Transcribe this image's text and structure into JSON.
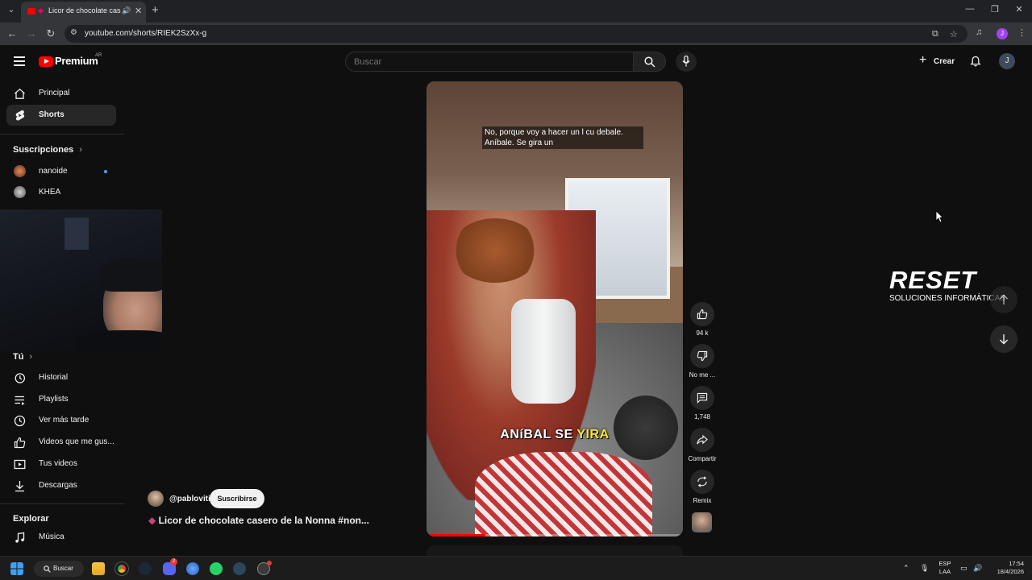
{
  "browser": {
    "tab_title": "Licor de chocolate casero",
    "url": "youtube.com/shorts/RIEK2SzXx-g",
    "profile_initial": "J"
  },
  "header": {
    "brand": "Premium",
    "country_code": "AR",
    "search_placeholder": "Buscar",
    "create_label": "Crear",
    "avatar_initial": "J"
  },
  "sidebar": {
    "nav": [
      {
        "label": "Principal",
        "icon": "home-icon"
      },
      {
        "label": "Shorts",
        "icon": "shorts-icon"
      }
    ],
    "subscriptions_heading": "Suscripciones",
    "subscriptions": [
      {
        "label": "nanoide",
        "live_dot": true
      },
      {
        "label": "KHEA",
        "live_dot": false
      }
    ],
    "you_heading": "Tú",
    "you_items": [
      {
        "label": "Historial",
        "icon": "history-icon"
      },
      {
        "label": "Playlists",
        "icon": "playlists-icon"
      },
      {
        "label": "Ver más tarde",
        "icon": "watch-later-icon"
      },
      {
        "label": "Videos que me gus...",
        "icon": "liked-videos-icon"
      },
      {
        "label": "Tus videos",
        "icon": "your-videos-icon"
      },
      {
        "label": "Descargas",
        "icon": "downloads-icon"
      }
    ],
    "explore_heading": "Explorar",
    "explore_items": [
      {
        "label": "Música",
        "icon": "music-icon"
      }
    ]
  },
  "short": {
    "caption_top": "No, porque voy a hacer un l cu debale. Aníbale. Se gira un",
    "caption_big_a": "ANíBAL SE ",
    "caption_big_b": "YIRA",
    "progress": 0.23,
    "channel": "@pabloviti",
    "subscribe_label": "Suscribirse",
    "title": "Licor de chocolate casero de la Nonna #non...",
    "actions": {
      "likes": "94 k",
      "dislike": "No me ...",
      "comments": "1,748",
      "share": "Compartir",
      "remix": "Remix"
    }
  },
  "overlay": {
    "brand": "RESET",
    "tagline": "SOLUCIONES INFORMÁTICAS"
  },
  "taskbar": {
    "search_label": "Buscar",
    "lang_top": "ESP",
    "lang_bottom": "LAA",
    "time": "17:54",
    "date": "18/4/2026",
    "discord_badge": "2"
  },
  "colors": {
    "accent_red": "#ff0000",
    "caption_highlight": "#ffe631",
    "background": "#0f0f0f"
  }
}
